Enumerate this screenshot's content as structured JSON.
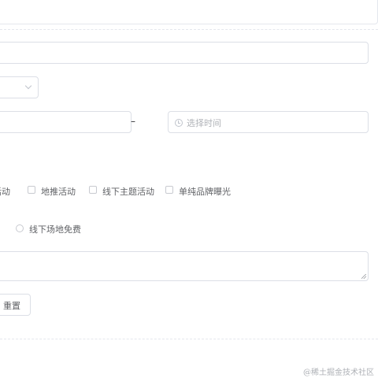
{
  "form": {
    "time_placeholder": "选择时间",
    "range_separator": "–",
    "activity_types": [
      {
        "label": "活动",
        "checked": false
      },
      {
        "label": "地推活动",
        "checked": false
      },
      {
        "label": "线下主题活动",
        "checked": false
      },
      {
        "label": "单纯品牌曝光",
        "checked": false
      }
    ],
    "resource_option": {
      "label": "线下场地免费",
      "selected": false
    },
    "reset_label": "重置"
  },
  "watermark": "@稀土掘金技术社区"
}
